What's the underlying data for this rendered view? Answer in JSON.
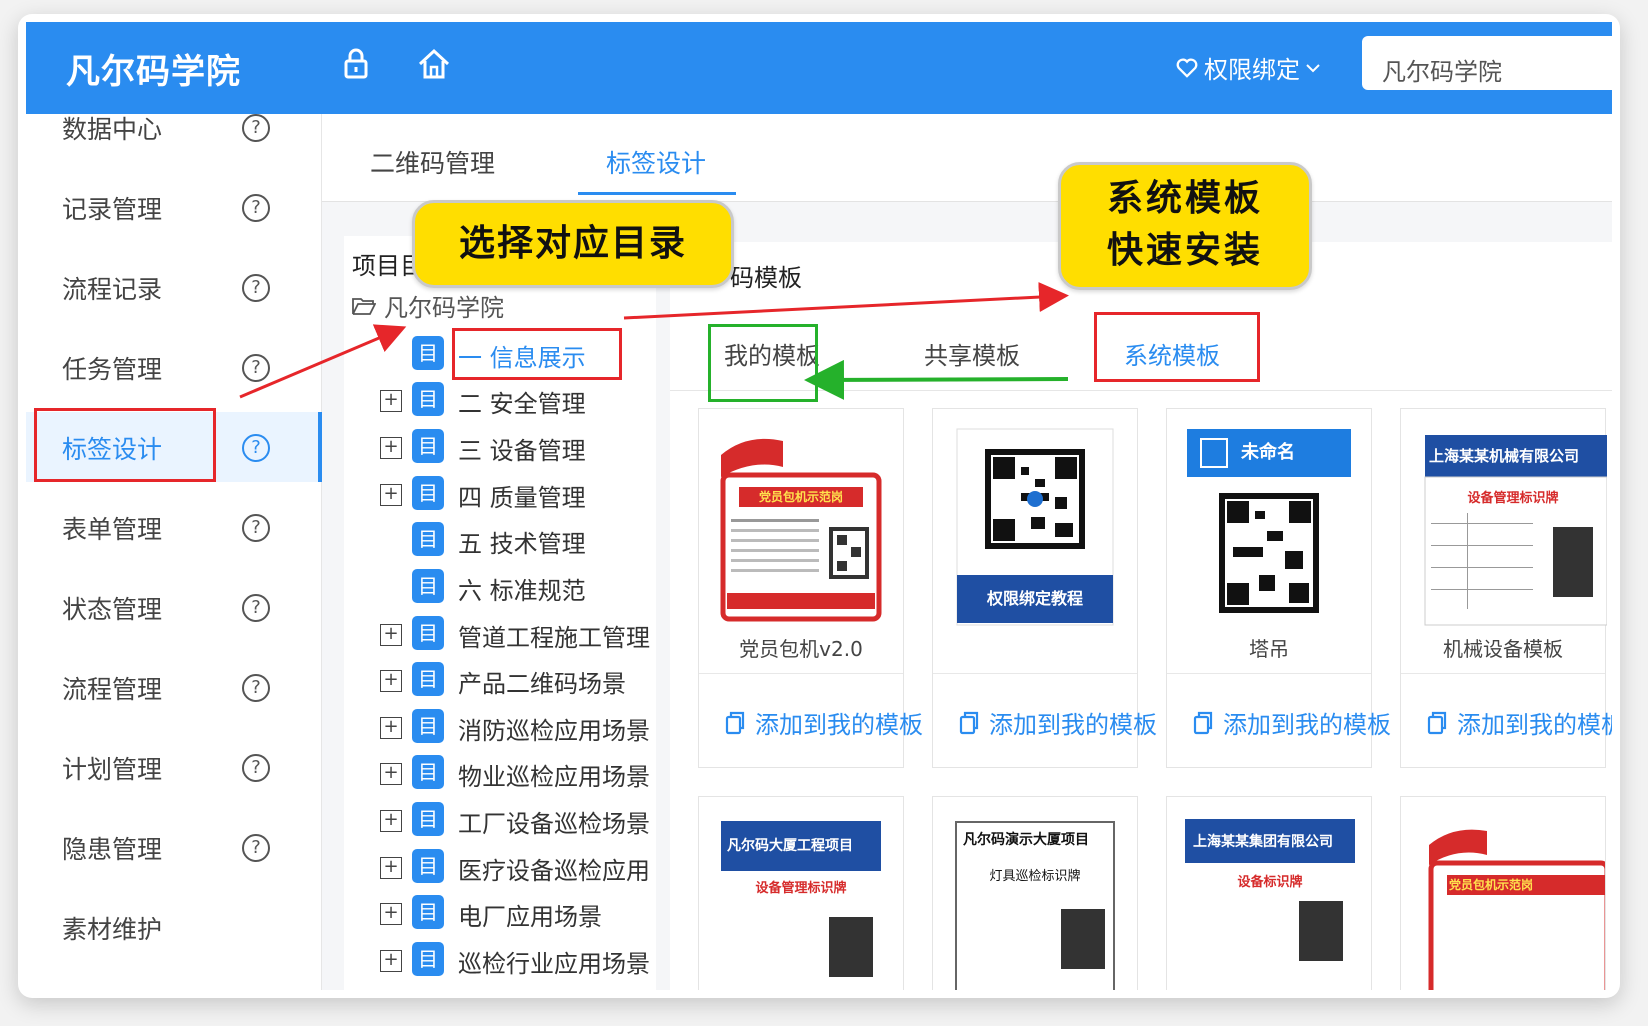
{
  "header": {
    "brand": "凡尔码学院",
    "permission": "权限绑定",
    "search_value": "凡尔码学院"
  },
  "sidebar": {
    "items": [
      {
        "label": "数据中心"
      },
      {
        "label": "记录管理"
      },
      {
        "label": "流程记录"
      },
      {
        "label": "任务管理"
      },
      {
        "label": "标签设计"
      },
      {
        "label": "表单管理"
      },
      {
        "label": "状态管理"
      },
      {
        "label": "流程管理"
      },
      {
        "label": "计划管理"
      },
      {
        "label": "隐患管理"
      },
      {
        "label": "素材维护"
      }
    ],
    "help_glyph": "?"
  },
  "top_tabs": [
    {
      "label": "二维码管理"
    },
    {
      "label": "标签设计"
    }
  ],
  "tree": {
    "title": "项目目录",
    "root": "凡尔码学院",
    "book_glyph": "目",
    "plus_glyph": "+",
    "items": [
      {
        "label": "一 信息展示"
      },
      {
        "label": "二 安全管理"
      },
      {
        "label": "三 设备管理"
      },
      {
        "label": "四 质量管理"
      },
      {
        "label": "五 技术管理"
      },
      {
        "label": "六 标准规范"
      },
      {
        "label": "管道工程施工管理"
      },
      {
        "label": "产品二维码场景"
      },
      {
        "label": "消防巡检应用场景"
      },
      {
        "label": "物业巡检应用场景"
      },
      {
        "label": "工厂设备巡检场景"
      },
      {
        "label": "医疗设备巡检应用"
      },
      {
        "label": "电厂应用场景"
      },
      {
        "label": "巡检行业应用场景"
      }
    ]
  },
  "template_panel": {
    "title": "码模板",
    "tabs": [
      {
        "label": "我的模板"
      },
      {
        "label": "共享模板"
      },
      {
        "label": "系统模板"
      }
    ],
    "cards": [
      {
        "name": "党员包机v2.0",
        "add_label": "添加到我的模板",
        "thumb_banner": "党员包机示范岗"
      },
      {
        "name": "",
        "add_label": "添加到我的模板",
        "thumb_banner": "权限绑定教程"
      },
      {
        "name": "塔吊",
        "add_label": "添加到我的模板",
        "thumb_banner": "未命名"
      },
      {
        "name": "机械设备模板",
        "add_label": "添加到我的模板",
        "thumb_banner": "上海某某机械有限公司",
        "thumb_sub": "设备管理标识牌"
      }
    ],
    "cards_row2": [
      {
        "thumb_banner": "凡尔码大厦工程项目",
        "thumb_sub": "设备管理标识牌"
      },
      {
        "thumb_banner": "凡尔码演示大厦项目",
        "thumb_sub": "灯具巡检标识牌"
      },
      {
        "thumb_banner": "上海某某集团有限公司",
        "thumb_sub": "设备标识牌"
      },
      {
        "thumb_banner": "党员包机示范岗"
      }
    ]
  },
  "callouts": {
    "select_dir": "选择对应目录",
    "sys_template_line1": "系统模板",
    "sys_template_line2": "快速安装"
  },
  "colors": {
    "primary": "#2a8cf0",
    "annotation_red": "#e6262a",
    "annotation_green": "#25b12b",
    "callout_yellow": "#ffde00"
  }
}
